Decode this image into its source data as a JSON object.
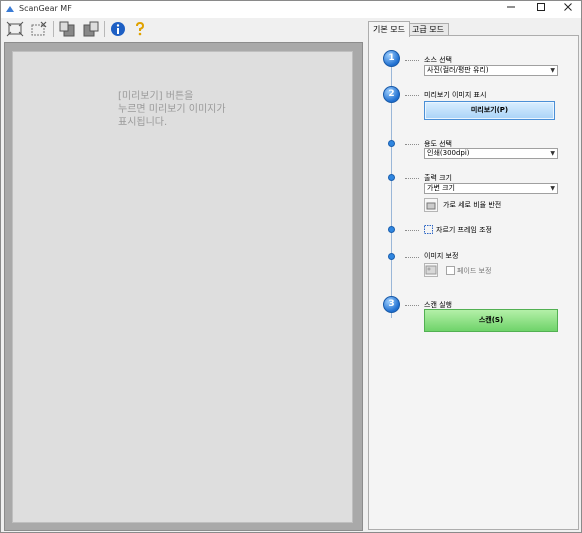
{
  "window": {
    "title": "ScanGear MF"
  },
  "colors": {
    "step_blue": "#1f6fd0",
    "preview_button": "#a9d3f7",
    "scan_button": "#6fd36a",
    "canvas_bg": "#a9a9a9"
  },
  "toolbar": {
    "icons": [
      "autocrop-icon",
      "delete-crop-icon",
      "rotate-left-icon",
      "rotate-right-icon",
      "info-icon",
      "help-icon"
    ]
  },
  "preview": {
    "message": "[미리보기] 버튼을\n누르면 미리보기 이미지가\n표시됩니다."
  },
  "tabs": [
    {
      "label": "기본 모드"
    },
    {
      "label": "고급 모드"
    }
  ],
  "steps": {
    "source": {
      "number": "1",
      "label": "소스 선택",
      "value": "사진(컬러/평판 유리)"
    },
    "preview": {
      "number": "2",
      "label": "미리보기 이미지 표시",
      "button": "미리보기(P)"
    },
    "purpose": {
      "label": "용도 선택",
      "value": "인쇄(300dpi)"
    },
    "output": {
      "label": "출력 크기",
      "value": "가변 크기",
      "swap_label": "가로 세로 비율 반전"
    },
    "crop": {
      "label": "자르기 프레임 조정"
    },
    "correction": {
      "label": "이미지 보정",
      "fade_label": "페이드 보정",
      "fade_checked": false
    },
    "scan": {
      "number": "3",
      "label": "스캔 실행",
      "button": "스캔(S)"
    }
  }
}
